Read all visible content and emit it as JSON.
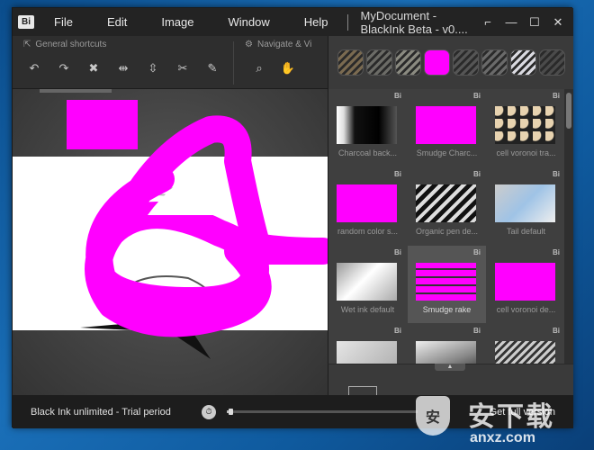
{
  "app": {
    "logo_text": "Bi",
    "title": "MyDocument - BlackInk Beta - v0....",
    "menu": [
      "File",
      "Edit",
      "Image",
      "Window",
      "Help"
    ],
    "window_buttons": {
      "restore": "⌐",
      "minimize": "—",
      "maximize": "☐",
      "close": "✕"
    }
  },
  "toolbar": {
    "general_title": "General shortcuts",
    "navigate_title": "Navigate & Vi",
    "general_tools": [
      {
        "name": "undo-icon",
        "glyph": "↶"
      },
      {
        "name": "redo-icon",
        "glyph": "↷"
      },
      {
        "name": "clear-icon",
        "glyph": "✖"
      },
      {
        "name": "flip-horizontal-icon",
        "glyph": "⇹"
      },
      {
        "name": "flip-vertical-icon",
        "glyph": "⇳"
      },
      {
        "name": "cut-icon",
        "glyph": "✂"
      },
      {
        "name": "fill-icon",
        "glyph": "✎"
      }
    ],
    "navigate_tools": [
      {
        "name": "zoom-icon",
        "glyph": "⌕"
      },
      {
        "name": "pan-hand-icon",
        "glyph": "✋"
      }
    ]
  },
  "brush_strip": [
    {
      "name": "brush-pencil",
      "color": "#7a6a50"
    },
    {
      "name": "brush-leaf",
      "color": "#6b6b66"
    },
    {
      "name": "brush-charcoal-strip",
      "color": "#8a8a80"
    },
    {
      "name": "brush-magenta",
      "color": "#ff00ff"
    },
    {
      "name": "brush-organic",
      "color": "#555555"
    },
    {
      "name": "brush-smudge",
      "color": "#6a6a6a"
    },
    {
      "name": "brush-eraser",
      "color": "#d9d9e0"
    },
    {
      "name": "brush-rake",
      "color": "#4a4a4a"
    }
  ],
  "brushes": [
    {
      "label": "Charcoal back...",
      "badge": "Bi",
      "style": "charcoal",
      "selected": false
    },
    {
      "label": "Smudge Charc...",
      "badge": "Bi",
      "style": "magenta",
      "selected": false
    },
    {
      "label": "cell voronoi tra...",
      "badge": "Bi",
      "style": "voronoi",
      "selected": false
    },
    {
      "label": "random color s...",
      "badge": "Bi",
      "style": "magenta",
      "selected": false
    },
    {
      "label": "Organic pen de...",
      "badge": "Bi",
      "style": "organic",
      "selected": false
    },
    {
      "label": "Tail default",
      "badge": "Bi",
      "style": "tail",
      "selected": false
    },
    {
      "label": "Wet ink default",
      "badge": "Bi",
      "style": "wetink",
      "selected": false
    },
    {
      "label": "Smudge rake",
      "badge": "Bi",
      "style": "smudgerake",
      "selected": true
    },
    {
      "label": "cell voronoi de...",
      "badge": "Bi",
      "style": "magenta",
      "selected": false
    },
    {
      "label": "",
      "badge": "Bi",
      "style": "grey1",
      "selected": false
    },
    {
      "label": "",
      "badge": "Bi",
      "style": "grey2",
      "selected": false
    },
    {
      "label": "",
      "badge": "Bi",
      "style": "grey3",
      "selected": false
    }
  ],
  "status": {
    "trial_text": "Black Ink unlimited - Trial period",
    "trial_progress": 0.02,
    "full_version": "Get full version"
  },
  "watermark": {
    "shield_text": "安",
    "cn_text": "安下载",
    "url": "anxz.com"
  },
  "colors": {
    "accent": "#ff00ff"
  }
}
